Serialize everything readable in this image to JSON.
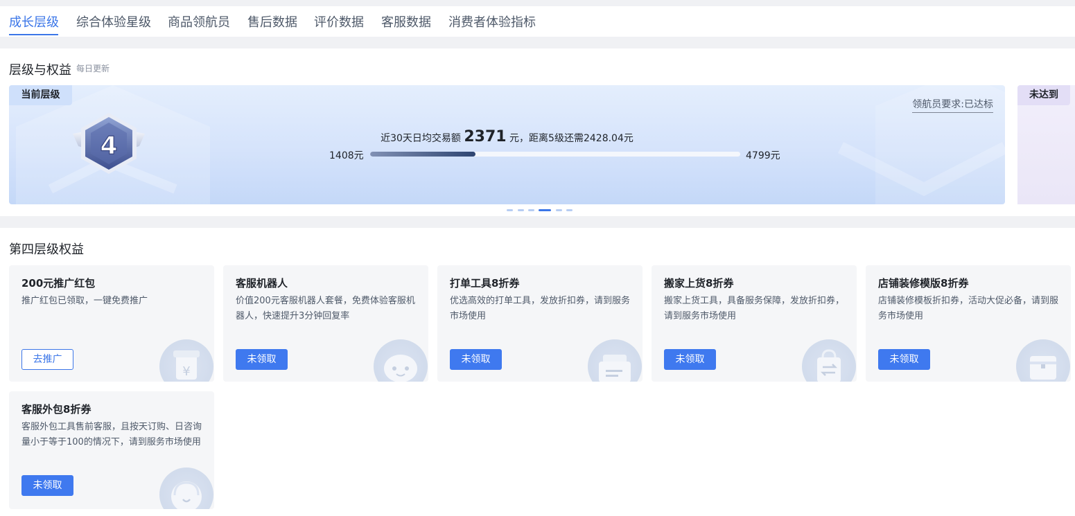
{
  "tabs": [
    {
      "label": "成长层级",
      "active": true
    },
    {
      "label": "综合体验星级"
    },
    {
      "label": "商品领航员"
    },
    {
      "label": "售后数据"
    },
    {
      "label": "评价数据"
    },
    {
      "label": "客服数据"
    },
    {
      "label": "消费者体验指标"
    }
  ],
  "level": {
    "title": "层级与权益",
    "subtitle": "每日更新",
    "current_tag": "当前层级",
    "badge_number": "4",
    "requirement": "领航员要求:已达标",
    "progress_prefix": "近30天日均交易额 ",
    "progress_value": "2371",
    "progress_suffix": " 元，距离5级还需2428.04元",
    "progress_min": "1408元",
    "progress_max": "4799元",
    "progress_fraction": 0.285,
    "next_tag": "未达到",
    "carousel": {
      "count": 6,
      "active_index": 3
    }
  },
  "benefits": {
    "title": "第四层级权益",
    "items": [
      {
        "title": "200元推广红包",
        "desc": "推广红包已领取，一键免费推广",
        "button": "去推广",
        "style": "outline",
        "icon": "red-packet-icon"
      },
      {
        "title": "客服机器人",
        "desc": "价值200元客服机器人套餐，免费体验客服机器人，快速提升3分钟回复率",
        "button": "未领取",
        "style": "primary",
        "icon": "robot-icon"
      },
      {
        "title": "打单工具8折券",
        "desc": "优选高效的打单工具，发放折扣券，请到服务市场使用",
        "button": "未领取",
        "style": "primary",
        "icon": "printer-icon"
      },
      {
        "title": "搬家上货8折券",
        "desc": "搬家上货工具，具备服务保障，发放折扣券，请到服务市场使用",
        "button": "未领取",
        "style": "primary",
        "icon": "shopping-bag-icon"
      },
      {
        "title": "店铺装修模版8折券",
        "desc": "店铺装修模板折扣券，活动大促必备，请到服务市场使用",
        "button": "未领取",
        "style": "primary",
        "icon": "store-template-icon"
      },
      {
        "title": "客服外包8折券",
        "desc": "客服外包工具售前客服，且按天订购、日咨询量小于等于100的情况下，请到服务市场使用",
        "button": "未领取",
        "style": "primary",
        "icon": "headset-icon"
      }
    ]
  },
  "colors": {
    "accent": "#3b76e8",
    "card_bg": "#f5f6f8"
  }
}
